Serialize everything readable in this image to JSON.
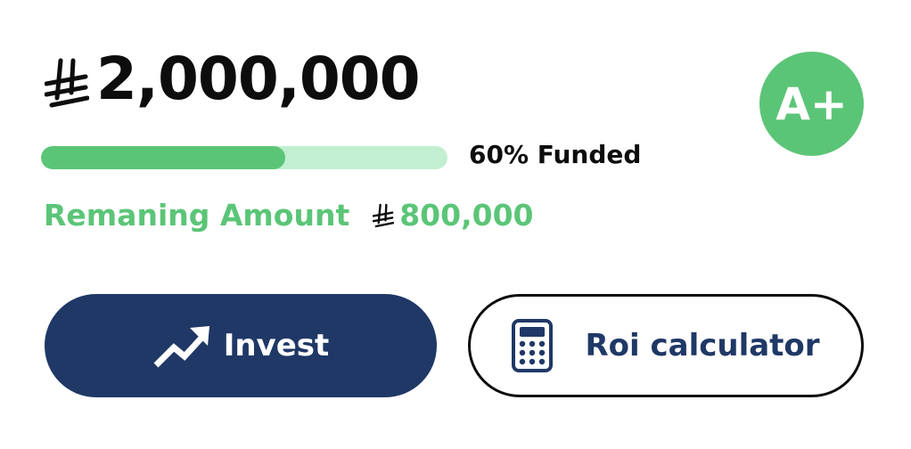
{
  "amount": {
    "currency_icon": "riyal-currency-icon",
    "value": "2,000,000"
  },
  "grade": {
    "label": "A+",
    "color": "#5bc577"
  },
  "progress": {
    "percent": 60,
    "label": "60% Funded",
    "fill_color": "#5bc577",
    "track_color": "#c2efd0"
  },
  "remaining": {
    "label": "Remaning Amount",
    "currency_icon": "riyal-currency-icon",
    "value": "800,000"
  },
  "actions": {
    "invest": {
      "label": "Invest",
      "icon": "trending-up-icon",
      "bg_color": "#1f3866"
    },
    "roi": {
      "label": "Roi calculator",
      "icon": "calculator-icon",
      "text_color": "#1f3866"
    }
  }
}
